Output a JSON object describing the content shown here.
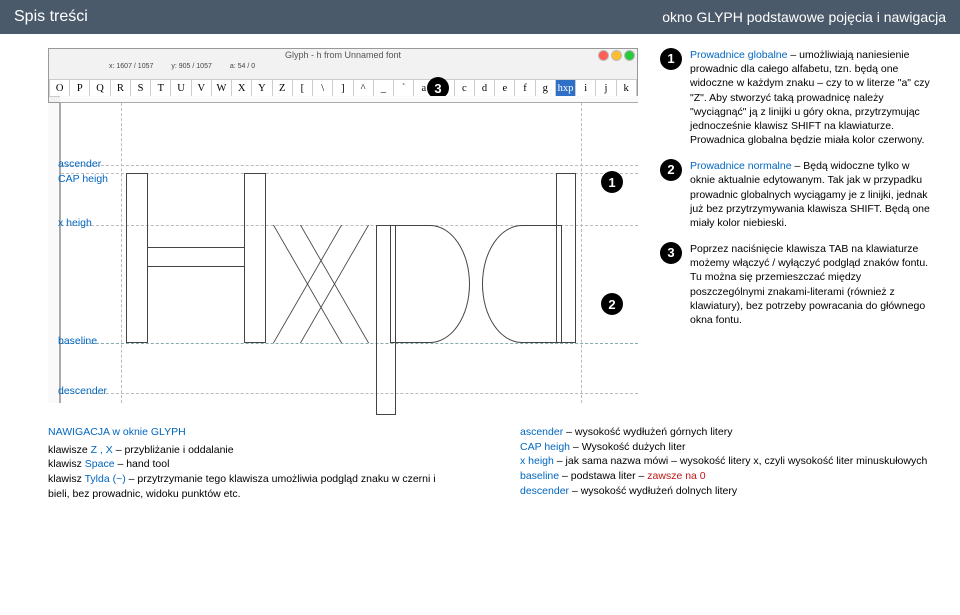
{
  "header": {
    "left": "Spis treści",
    "right": "okno GLYPH podstawowe pojęcia i nawigacja"
  },
  "screenshot": {
    "title": "Glyph - h from Unnamed font",
    "coords": {
      "x": "x: 1607 / 1057",
      "y": "y: 905 / 1057",
      "a": "a: 54 / 0"
    },
    "glyphs": [
      "O",
      "P",
      "Q",
      "R",
      "S",
      "T",
      "U",
      "V",
      "W",
      "X",
      "Y",
      "Z",
      "[",
      "\\",
      "]",
      "^",
      "_",
      "`",
      "a",
      "b",
      "c",
      "d",
      "e",
      "f",
      "g",
      "hxp",
      "i",
      "j",
      "k"
    ],
    "labels": {
      "ascender": "ascender",
      "capheight": "CAP heigh",
      "xheight": "x heigh",
      "baseline": "baseline",
      "descender": "descender"
    },
    "markers": {
      "m1": "1",
      "m2": "2",
      "m3": "3"
    }
  },
  "items": {
    "i1_lead": "Prowadnice globalne",
    "i1_body": " – umożliwiają naniesienie prowadnic dla całego alfabetu, tzn. będą one widoczne w każdym znaku – czy to w literze \"a\" czy \"Z\". Aby stworzyć taką prowadnicę należy \"wyciągnąć\" ją z linijki u góry okna, przytrzymując jednocześnie klawisz SHIFT na klawiaturze. Prowadnica globalna będzie miała kolor czerwony.",
    "i2_lead": "Prowadnice normalne",
    "i2_body": " – Będą widoczne tylko w oknie aktualnie edytowanym. Tak jak w przypadku prowadnic globalnych wyciągamy je z linijki, jednak już bez przytrzymywania klawisza SHIFT. Będą one miały kolor niebieski.",
    "i3_body": "Poprzez naciśnięcie klawisza TAB na klawiaturze możemy włączyć / wyłączyć podgląd znaków fontu. Tu można się przemieszczać między poszczególnymi znakami-literami (również z klawiatury), bez potrzeby powracania do głównego okna fontu."
  },
  "bottom": {
    "nav_title": "NAWIGACJA w oknie GLYPH",
    "nav_l1a": "klawisze ",
    "nav_l1b": "Z , X",
    "nav_l1c": " – przybliżanie i oddalanie",
    "nav_l2a": "klawisz ",
    "nav_l2b": "Space",
    "nav_l2c": " – hand tool",
    "nav_l3a": "klawisz ",
    "nav_l3b": "Tylda (~)",
    "nav_l3c": " – przytrzymanie tego klawisza umożliwia podgląd znaku w czerni i bieli, bez prowadnic, widoku punktów etc.",
    "r1a": "ascender",
    "r1b": " – wysokość wydłużeń górnych litery",
    "r2a": "CAP heigh",
    "r2b": " – Wysokość dużych liter",
    "r3a": "x heigh",
    "r3b": " – jak sama nazwa mówi – wysokość litery x, czyli wysokość liter minuskułowych",
    "r4a": "baseline",
    "r4b": " – podstawa liter – ",
    "r4c": "zawsze na 0",
    "r5a": "descender",
    "r5b": " – wysokość wydłużeń dolnych litery"
  }
}
